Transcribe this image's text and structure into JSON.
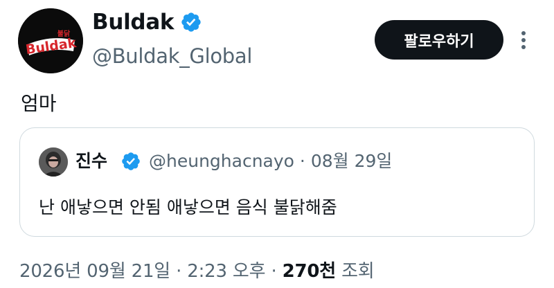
{
  "author": {
    "display_name": "Buldak",
    "handle": "@Buldak_Global",
    "avatar_icon": "buldak-logo",
    "logo_text": "Buldak",
    "logo_small_text": "불닭",
    "verified_icon": "verified-badge-icon"
  },
  "follow_label": "팔로우하기",
  "more_icon": "more-vertical-icon",
  "tweet_text": "엄마",
  "quote": {
    "name": "진수",
    "handle": "@heunghacnayo",
    "separator": "·",
    "date": "08월 29일",
    "text": "난 애낳으면 안됨 애낳으면 음식 불닭해줌"
  },
  "footer": {
    "date": "2026년 09월 21일",
    "sep1": "·",
    "time": "2:23 오후",
    "sep2": "·",
    "views_count": "270천",
    "views_label": "조회"
  },
  "colors": {
    "verified": "#1d9bf0",
    "button": "#0f1419",
    "muted": "#536471",
    "logo_red": "#d7262c"
  }
}
